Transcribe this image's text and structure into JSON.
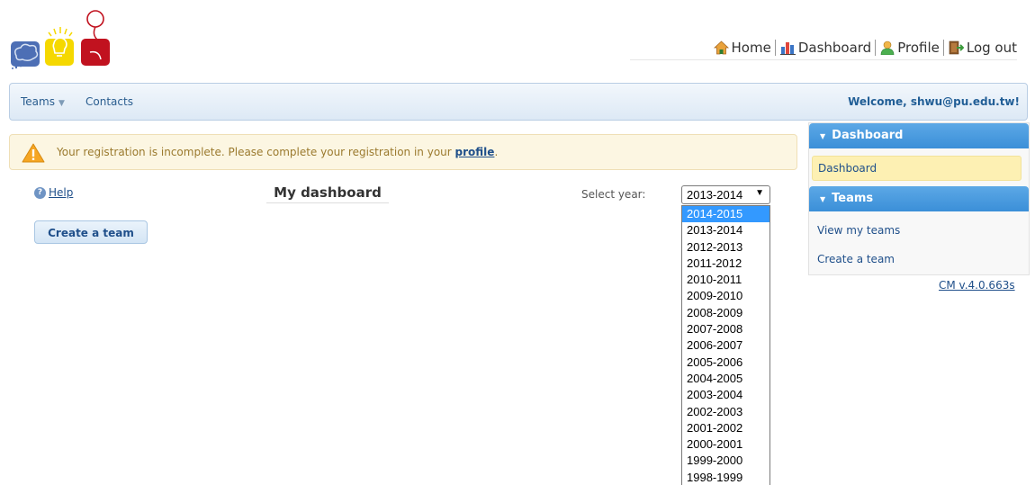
{
  "colors": {
    "accent": "#3b8fd8",
    "link": "#1f4f8a",
    "alert_bg": "#fcf6e2",
    "selected_option": "#3399ff"
  },
  "top_nav": {
    "home": "Home",
    "dashboard": "Dashboard",
    "profile": "Profile",
    "logout": "Log out",
    "icons": [
      "home-icon",
      "bar-chart-icon",
      "user-icon",
      "logout-door-icon"
    ]
  },
  "menu": {
    "teams": "Teams",
    "contacts": "Contacts",
    "welcome": "Welcome, shwu@pu.edu.tw!"
  },
  "alert": {
    "icon": "warning-icon",
    "message": "Your registration is incomplete. Please complete your registration in your ",
    "link": "profile",
    "suffix": "."
  },
  "main": {
    "help": "Help",
    "title": "My dashboard",
    "create_team": "Create a team",
    "select_year_label": "Select year:",
    "selected_year": "2013-2014",
    "highlighted_option": "2014-2015",
    "year_options": [
      "2014-2015",
      "2013-2014",
      "2012-2013",
      "2011-2012",
      "2010-2011",
      "2009-2010",
      "2008-2009",
      "2007-2008",
      "2006-2007",
      "2005-2006",
      "2004-2005",
      "2003-2004",
      "2002-2003",
      "2001-2002",
      "2000-2001",
      "1999-2000",
      "1998-1999"
    ]
  },
  "sidebar": {
    "dashboard_header": "Dashboard",
    "dashboard_item": "Dashboard",
    "teams_header": "Teams",
    "view_teams": "View my teams",
    "create_team": "Create a team"
  },
  "version": "CM v.4.0.663s"
}
